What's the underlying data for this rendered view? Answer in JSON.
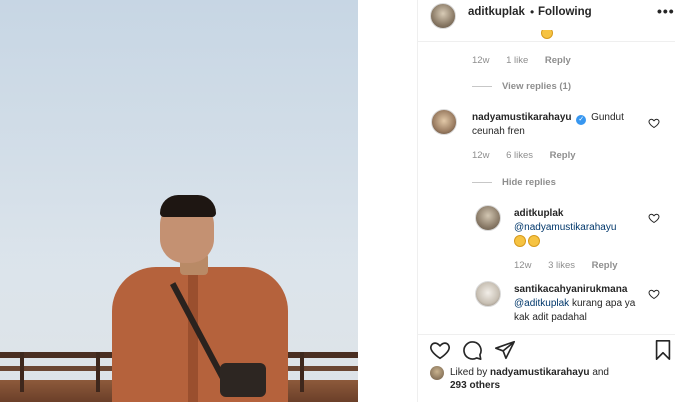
{
  "post": {
    "author": "aditkuplak",
    "follow_dot": "•",
    "follow_status": "Following",
    "more_menu": "•••"
  },
  "comments": {
    "partial": {
      "age": "12w",
      "likes": "1 like",
      "reply": "Reply"
    },
    "view_replies_1": "View replies (1)",
    "nadya": {
      "username": "nadyamustikarahayu",
      "verified_mark": "✓",
      "text": "Gundut ceunah fren",
      "age": "12w",
      "likes": "6 likes",
      "reply": "Reply"
    },
    "hide_replies": "Hide replies",
    "reply_adit": {
      "username": "aditkuplak",
      "mention": "@nadyamustikarahayu",
      "age": "12w",
      "likes": "3 likes",
      "reply": "Reply"
    },
    "reply_santika": {
      "username": "santikacahyanirukmana",
      "mention": "@aditkuplak",
      "text": "kurang apa ya kak adit padahal"
    }
  },
  "liked_by": {
    "prefix": "Liked by",
    "user": "nadyamustikarahayu",
    "and": "and",
    "others": "293 others"
  },
  "icons": {
    "like": "heart-icon",
    "comment": "comment-icon",
    "share": "share-icon",
    "save": "bookmark-icon"
  }
}
